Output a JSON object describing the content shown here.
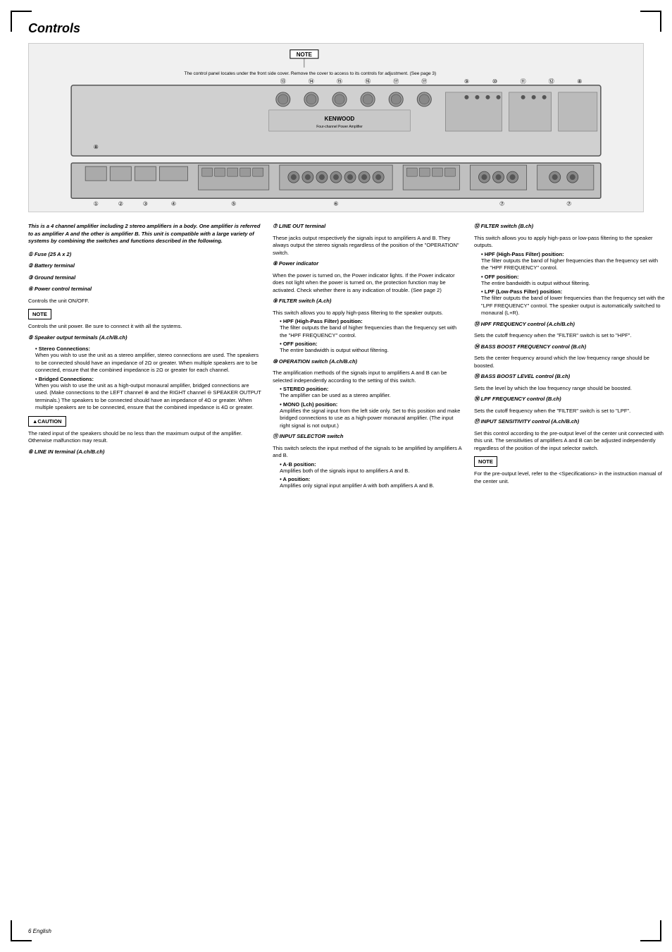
{
  "page": {
    "title": "Controls",
    "footer": "6  English",
    "note_box_label": "NOTE",
    "note_description": "The control panel locates under the front side cover. Remove the cover to access to its controls for adjustment. (See page 3)"
  },
  "intro": {
    "text": "This is a 4 channel amplifier including 2 stereo amplifiers in a body. One amplifier is referred to as amplifier A and the other is amplifier B. This unit is compatible with a large variety of systems by combining the switches and functions described in the following."
  },
  "items": {
    "item1": {
      "num": "① ",
      "header": "Fuse (25 A x 2)"
    },
    "item2": {
      "num": "② ",
      "header": "Battery terminal"
    },
    "item3": {
      "num": "③ ",
      "header": "Ground terminal"
    },
    "item4": {
      "num": "④ ",
      "header": "Power control terminal",
      "text": "Controls the unit ON/OFF.",
      "note_label": "NOTE",
      "note_text": "Controls the unit power. Be sure to connect it with all the systems."
    },
    "item5": {
      "num": "⑤ ",
      "header": "Speaker output terminals (A.ch/B.ch)",
      "sub1_header": "• Stereo Connections:",
      "sub1_text": "When you wish to use the unit as a stereo amplifier, stereo connections are used. The speakers to be connected should have an impedance of 2Ω or greater. When multiple speakers are to be connected, ensure that the combined impedance is 2Ω or greater for each channel.",
      "sub2_header": "• Bridged Connections:",
      "sub2_text": "When you wish to use the unit as a high-output monaural amplifier, bridged connections are used. (Make connections to the LEFT channel ⊕ and the RIGHT channel ⊖ SPEAKER OUTPUT terminals.) The speakers to be connected should have an impedance of 4Ω or greater. When multiple speakers are to be connected, ensure that the combined impedance is 4Ω or greater.",
      "caution_label": "▲CAUTION",
      "caution_text": "The rated input of the speakers should be no less than the maximum output of the amplifier. Otherwise malfunction may result."
    },
    "item6": {
      "num": "⑥ ",
      "header": "LINE IN terminal (A.ch/B.ch)"
    },
    "item7": {
      "num": "⑦ ",
      "header": "LINE OUT terminal",
      "text": "These jacks output respectively the signals input to amplifiers A and B. They always output the stereo signals regardless of the position of the \"OPERATION\" switch."
    },
    "item8": {
      "num": "⑧ ",
      "header": "Power indicator",
      "text": "When the power is turned on, the Power indicator lights. If the Power indicator does not light when the power is turned on, the protection function may be activated. Check whether there is any indication of trouble. (See page 2)"
    },
    "item9": {
      "num": "⑨ ",
      "header": "FILTER switch (A.ch)",
      "text": "This switch allows you to apply high-pass filtering to the speaker outputs.",
      "sub1_header": "• HPF (High-Pass Filter) position:",
      "sub1_text": "The filter outputs the band of higher frequencies than the frequency set with the \"HPF FREQUENCY\" control.",
      "sub2_header": "• OFF position:",
      "sub2_text": "The entire bandwidth is output without filtering."
    },
    "item10": {
      "num": "⑩ ",
      "header": "OPERATION switch (A.ch/B.ch)",
      "text": "The amplification methods of the signals input to amplifiers A and B can be selected independently according to the setting of this switch.",
      "sub1_header": "• STEREO position:",
      "sub1_text": "The amplifier can be used as a stereo amplifier.",
      "sub2_header": "• MONO (Lch) position:",
      "sub2_text": "Amplifies the signal input from the left side only. Set to this position and make bridged connections to use as a high-power monaural amplifier. (The input right signal is not output.)"
    },
    "item11": {
      "num": "⑪ ",
      "header": "INPUT SELECTOR switch",
      "text": "This switch selects the input method of the signals to be amplified by amplifiers A and B.",
      "sub1_header": "• A·B position:",
      "sub1_text": "Amplifies both of the signals input to amplifiers A and B.",
      "sub2_header": "• A position:",
      "sub2_text": "Amplifies only signal input amplifier A with both amplifiers A and B."
    },
    "item12": {
      "num": "⑫ ",
      "header": "FILTER switch (B.ch)",
      "text": "This switch allows you to apply high-pass or low-pass filtering to the speaker outputs.",
      "sub1_header": "• HPF (High-Pass Filter) position:",
      "sub1_text": "The filter outputs the band of higher frequencies than the frequency set with the \"HPF FREQUENCY\" control.",
      "sub2_header": "• OFF position:",
      "sub2_text": "The entire bandwidth is output without filtering.",
      "sub3_header": "• LPF (Low-Pass Filter) position:",
      "sub3_text": "The filter outputs the band of lower frequencies than the frequency set with the \"LPF FREQUENCY\" control. The speaker output is automatically switched to monaural (L+R)."
    },
    "item13": {
      "num": "⑬ ",
      "header": "HPF FREQUENCY control  (A.ch/B.ch)",
      "text": "Sets the cutoff frequency when the \"FILTER\" switch is set to \"HPF\"."
    },
    "item14": {
      "num": "⑭ ",
      "header": "BASS BOOST FREQUENCY control (B.ch)",
      "text": "Sets the center frequency around which the low frequency range should be boosted."
    },
    "item15": {
      "num": "⑮ ",
      "header": "BASS BOOST LEVEL control (B.ch)",
      "text": "Sets the level by which the low frequency range should be boosted."
    },
    "item16": {
      "num": "⑯ ",
      "header": "LPF FREQUENCY control  (B.ch)",
      "text": "Sets the cutoff frequency when the \"FILTER\" switch is set to \"LPF\"."
    },
    "item17": {
      "num": "⑰ ",
      "header": "INPUT SENSITIVITY control  (A.ch/B.ch)",
      "text": "Set this control according to the pre-output level of the center unit connected with this unit. The sensitivities of amplifiers A and B can be adjusted independently regardless of the position of the input selector switch.",
      "note_label": "NOTE",
      "note_text": "For the pre-output level, refer to the <Specifications> in the instruction manual of the center unit."
    }
  }
}
